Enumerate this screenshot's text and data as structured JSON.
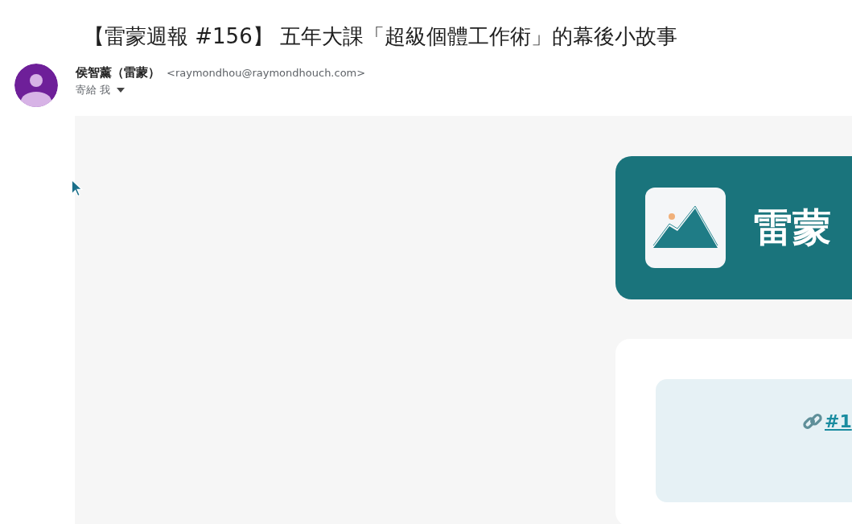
{
  "subject": "【雷蒙週報 #156】 五年大課「超級個體工作術」的幕後小故事",
  "sender": {
    "name": "侯智薰（雷蒙）",
    "email": "<raymondhou@raymondhouch.com>",
    "recipient": "寄給 我"
  },
  "newsletter": {
    "banner_title": "雷蒙",
    "link_text": "#1"
  }
}
